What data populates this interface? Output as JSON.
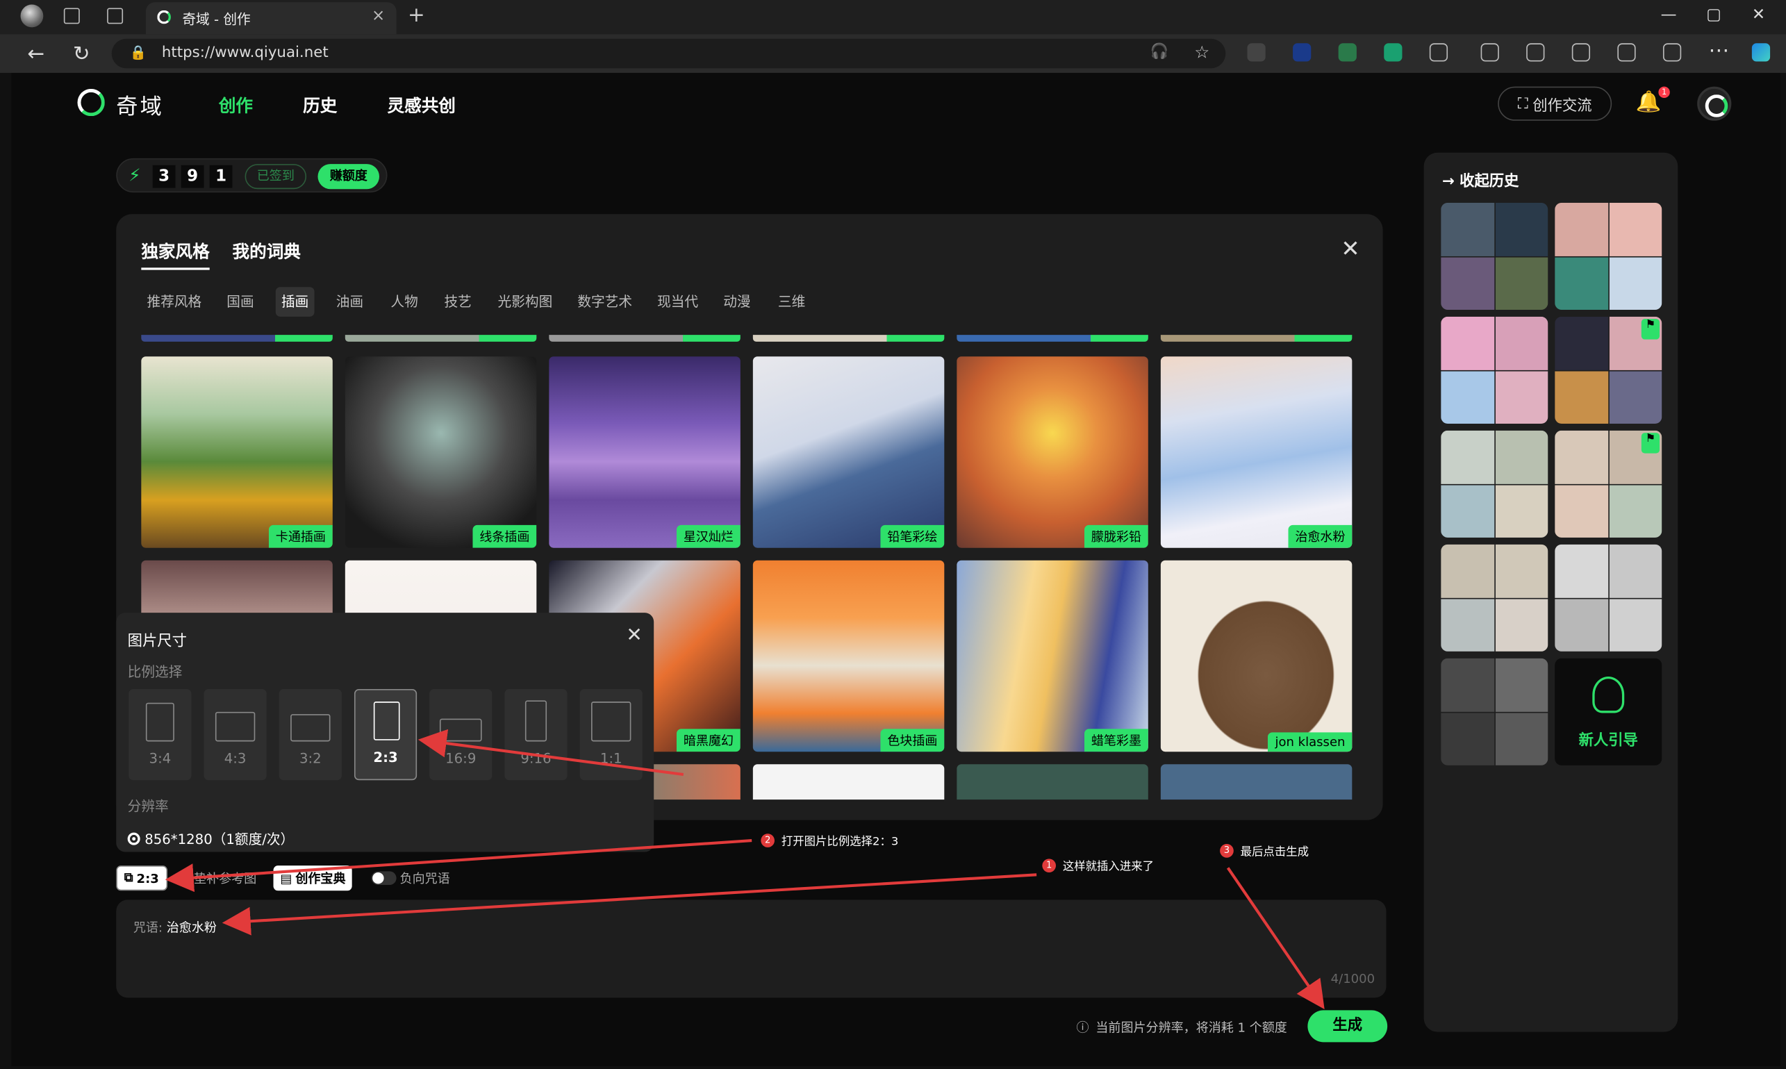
{
  "browser": {
    "tab_title": "奇域 - 创作",
    "url": "https://www.qiyuai.net",
    "new_tab": "+",
    "tab_close": "×",
    "win_min": "—",
    "win_max": "▢",
    "win_close": "✕"
  },
  "nav": {
    "logo": "奇域",
    "items": [
      "创作",
      "历史",
      "灵感共创"
    ],
    "active": "创作",
    "community_btn": "创作交流",
    "notification_count": "1"
  },
  "credits": {
    "digits": [
      "3",
      "9",
      "1"
    ],
    "signed_label": "已签到",
    "earn_label": "赚额度"
  },
  "style_panel": {
    "tabs": [
      "独家风格",
      "我的词典"
    ],
    "categories": [
      "推荐风格",
      "国画",
      "插画",
      "油画",
      "人物",
      "技艺",
      "光影构图",
      "数字艺术",
      "现当代",
      "动漫",
      "三维"
    ],
    "active_category": "插画",
    "row1": [
      "卡通插画",
      "线条插画",
      "星汉灿烂",
      "铅笔彩绘",
      "朦胧彩铅",
      "治愈水粉"
    ],
    "row2": [
      "",
      "",
      "暗黑魔幻",
      "色块插画",
      "蜡笔彩墨",
      "jon klassen"
    ]
  },
  "size_popup": {
    "title": "图片尺寸",
    "ratio_label": "比例选择",
    "ratios": [
      "3:4",
      "4:3",
      "3:2",
      "2:3",
      "16:9",
      "9:16",
      "1:1"
    ],
    "selected_ratio": "2:3",
    "resolution_label": "分辨率",
    "resolution_option": "856*1280（1额度/次）"
  },
  "toolbar": {
    "ratio_chip": "2:3",
    "reference_chip": "垫补参考图",
    "codex_chip": "创作宝典",
    "negative_label": "负向咒语"
  },
  "prompt": {
    "label": "咒语:",
    "value": "治愈水粉",
    "char_count": "4/1000"
  },
  "footer": {
    "cost_note": "当前图片分辨率，将消耗 1 个额度",
    "generate": "生成"
  },
  "history": {
    "title": "收起历史",
    "guide_label": "新人引导"
  },
  "annotations": [
    {
      "num": "1",
      "text": "这样就插入进来了"
    },
    {
      "num": "2",
      "text": "打开图片比例选择2：3"
    },
    {
      "num": "3",
      "text": "最后点击生成"
    }
  ],
  "colors": {
    "accent": "#2ee06a",
    "background": "#0b0b0b",
    "panel": "#1e1e1e",
    "annotation_red": "#e23b3b"
  }
}
